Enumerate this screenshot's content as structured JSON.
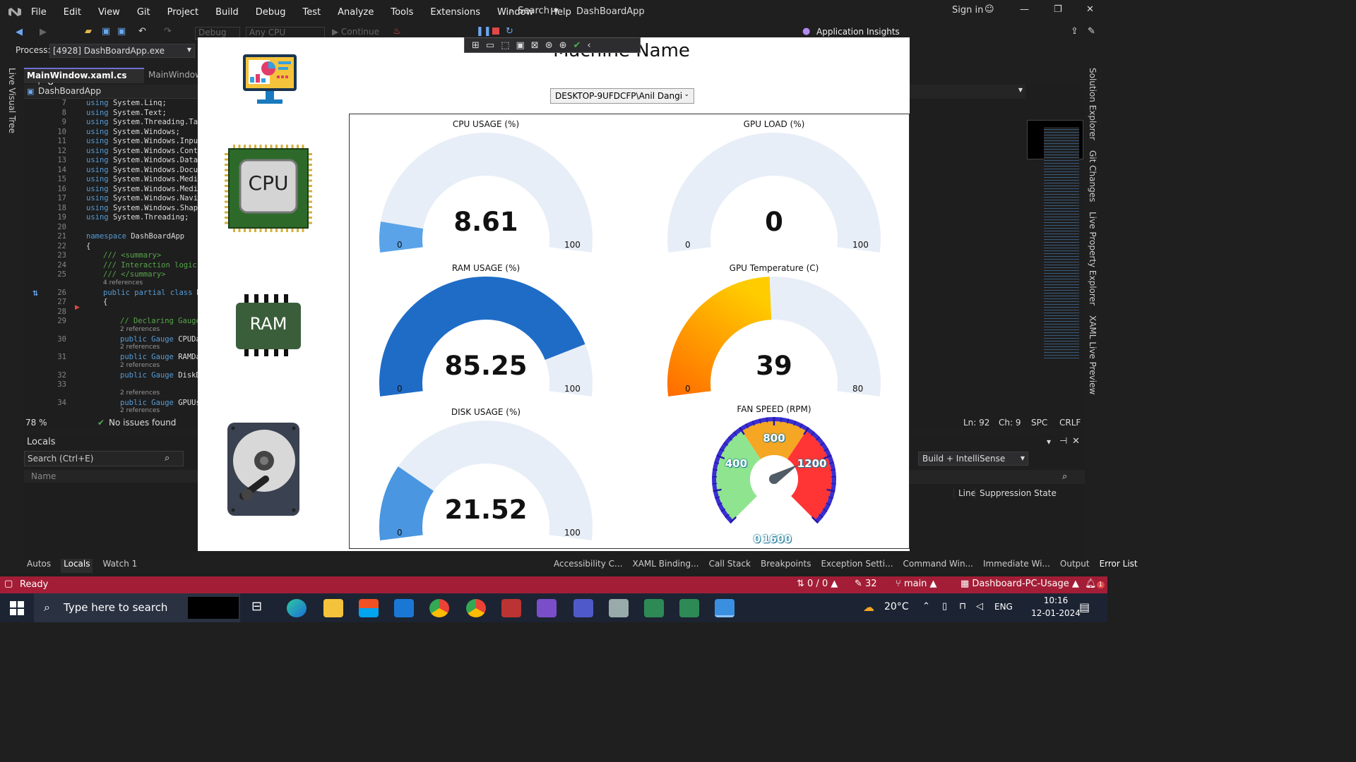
{
  "ide": {
    "menu": [
      "File",
      "Edit",
      "View",
      "Git",
      "Project",
      "Build",
      "Debug",
      "Test",
      "Analyze",
      "Tools",
      "Extensions",
      "Window",
      "Help"
    ],
    "search_label": "Search",
    "solution_name": "DashBoardApp",
    "sign_in": "Sign in",
    "toolbar": {
      "config": "Debug",
      "platform": "Any CPU",
      "continue": "Continue",
      "app_insights": "Application Insights"
    },
    "process_label": "Process:",
    "process_value": "[4928] DashBoardApp.exe",
    "tabs": [
      "MainWindow.xaml.cs",
      "MainWindow"
    ],
    "class_dropdown": "DashBoardApp",
    "left_side_tab": "Live Visual Tree",
    "right_side_tabs": [
      "Solution Explorer",
      "Git Changes",
      "Live Property Explorer",
      "XAML Live Preview"
    ],
    "code_lines": [
      {
        "n": "7",
        "k": "using",
        "t": "System.Linq;"
      },
      {
        "n": "8",
        "k": "using",
        "t": "System.Text;"
      },
      {
        "n": "9",
        "k": "using",
        "t": "System.Threading.Tas"
      },
      {
        "n": "10",
        "k": "using",
        "t": "System.Windows;"
      },
      {
        "n": "11",
        "k": "using",
        "t": "System.Windows.Input"
      },
      {
        "n": "12",
        "k": "using",
        "t": "System.Windows.Contr"
      },
      {
        "n": "13",
        "k": "using",
        "t": "System.Windows.Data;"
      },
      {
        "n": "14",
        "k": "using",
        "t": "System.Windows.Docum"
      },
      {
        "n": "15",
        "k": "using",
        "t": "System.Windows.Media"
      },
      {
        "n": "16",
        "k": "using",
        "t": "System.Windows.Media"
      },
      {
        "n": "17",
        "k": "using",
        "t": "System.Windows.Navig"
      },
      {
        "n": "18",
        "k": "using",
        "t": "System.Windows.Shape"
      },
      {
        "n": "19",
        "k": "using",
        "t": "System.Threading;"
      },
      {
        "n": "20",
        "k": "",
        "t": ""
      },
      {
        "n": "21",
        "k": "namespace",
        "t": "DashBoardApp"
      },
      {
        "n": "22",
        "k": "",
        "t": "{"
      },
      {
        "n": "23",
        "k": "",
        "c": "/// <summary>"
      },
      {
        "n": "24",
        "k": "",
        "c": "/// Interaction logic"
      },
      {
        "n": "25",
        "k": "",
        "c": "/// </summary>"
      },
      {
        "n": "26",
        "k": "public partial class",
        "t": "M"
      },
      {
        "n": "27",
        "k": "",
        "t": "{"
      },
      {
        "n": "28",
        "k": "",
        "t": ""
      },
      {
        "n": "29",
        "k": "",
        "c": "// Declaring Gauge"
      },
      {
        "n": "30",
        "k": "public Gauge",
        "t": "CPUDa"
      },
      {
        "n": "31",
        "k": "public Gauge",
        "t": "RAMDa"
      },
      {
        "n": "32",
        "k": "public Gauge",
        "t": "DiskD"
      },
      {
        "n": "33",
        "k": "",
        "t": ""
      },
      {
        "n": "34",
        "k": "public Gauge",
        "t": "GPUUs"
      }
    ],
    "refs": {
      "four": "4 references",
      "two": "2 references"
    },
    "zoom": "78 %",
    "issues": "No issues found",
    "ln": "Ln: 92",
    "ch": "Ch: 9",
    "spc": "SPC",
    "crlf": "CRLF",
    "locals": {
      "title": "Locals",
      "search_placeholder": "Search (Ctrl+E)",
      "col_name": "Name"
    },
    "bottom_tabs_left": [
      "Autos",
      "Locals",
      "Watch 1"
    ],
    "bottom_tabs_right": [
      "Accessibility C...",
      "XAML Binding...",
      "Call Stack",
      "Breakpoints",
      "Exception Setti...",
      "Command Win...",
      "Immediate Wi...",
      "Output",
      "Error List"
    ],
    "error_list": {
      "filter": "Build + IntelliSense",
      "col_line": "Line",
      "col_suppression": "Suppression State"
    },
    "status": {
      "ready": "Ready",
      "changes": "0 / 0",
      "pencil": "32",
      "branch": "main",
      "repo": "Dashboard-PC-Usage",
      "notif": "1"
    }
  },
  "app": {
    "title": "Machine Name",
    "machine_selected": "DESKTOP-9UFDCFP\\Anil Dangi",
    "gauges": [
      {
        "id": "cpu",
        "title": "CPU USAGE (%)",
        "value": 8.61,
        "display": "8.61",
        "min": "0",
        "max": "100",
        "max_num": 100
      },
      {
        "id": "gpu",
        "title": "GPU LOAD (%)",
        "value": 0,
        "display": "0",
        "min": "0",
        "max": "100",
        "max_num": 100
      },
      {
        "id": "ram",
        "title": "RAM USAGE (%)",
        "value": 85.25,
        "display": "85.25",
        "min": "0",
        "max": "100",
        "max_num": 100
      },
      {
        "id": "gputemp",
        "title": "GPU Temperature (C)",
        "value": 39,
        "display": "39",
        "min": "0",
        "max": "80",
        "max_num": 80
      },
      {
        "id": "disk",
        "title": "DISK USAGE (%)",
        "value": 21.52,
        "display": "21.52",
        "min": "0",
        "max": "100",
        "max_num": 100
      }
    ],
    "fan": {
      "title": "FAN SPEED (RPM)",
      "value": 1150,
      "labels": [
        "0",
        "400",
        "800",
        "1200",
        "1600"
      ]
    },
    "icons": {
      "cpu_text": "CPU",
      "ram_text": "RAM"
    },
    "colors": {
      "gauge_bg": "#e8eef7",
      "cpu": "#5aa3e8",
      "ram": "#1f6cc7",
      "disk": "#4a96e0",
      "temp_from": "#ff6a00",
      "temp_to": "#ffcc00"
    }
  },
  "taskbar": {
    "search_placeholder": "Type here to search",
    "weather": "20°C",
    "lang": "ENG",
    "time": "10:16",
    "date": "12-01-2024"
  }
}
